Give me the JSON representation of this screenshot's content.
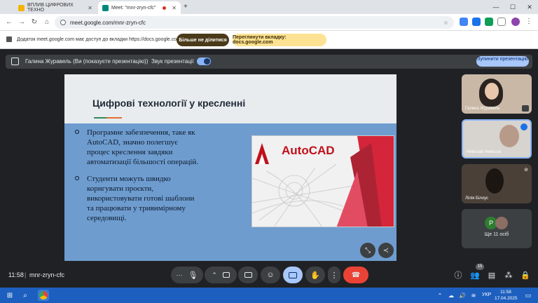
{
  "browser": {
    "tabs": [
      {
        "label": "ВПЛИВ ЦИФРОВИХ ТЕХНО",
        "favicon_color": "#f4b400"
      },
      {
        "label": "Meet: \"mnr-zryn-cfc\"",
        "favicon_color": "#00897b"
      }
    ],
    "new_tab": "+",
    "url": "meet.google.com/mnr-zryn-cfc",
    "window_controls": {
      "minimize": "—",
      "maximize": "☐",
      "close": "✕"
    }
  },
  "infobar": {
    "text": "Додаток meet.google.com має доступ до вкладки https://docs.google.com",
    "stop_sharing": "Більше не ділитися",
    "view_tab": "Переглянути вкладку: docs.google.com"
  },
  "presentation_bar": {
    "presenter": "Галина Журавель (Ви (показуєте презентацію))",
    "sound_label": "Звук презентації",
    "sound_on": true,
    "stop_button": "Зупинити презентацію"
  },
  "slide": {
    "title": "Цифрові технології у кресленні",
    "bullets": [
      [
        "Програмне забезпечення, таке як",
        "AutoCAD, значно полегшує",
        "процес креслення завдяки",
        "автоматизації більшості операцій."
      ],
      [
        "Студенти можуть швидко",
        "коригувати проєкти,",
        "використовувати готові шаблони",
        "та працювати у тривимірному",
        "середовищі."
      ]
    ],
    "image_text": "AutoCAD"
  },
  "participants": [
    {
      "name": "Галина Журавель",
      "bg": "#c9b8a6"
    },
    {
      "name": "Николай Невесов",
      "bg": "#d7d3cf"
    },
    {
      "name": "Лілія Білоус",
      "bg": "#4a4038"
    }
  ],
  "others": {
    "label": "Ще 11 осіб",
    "avatar_letter": "P"
  },
  "bottom": {
    "time": "11:58",
    "meeting_code": "mnr-zryn-cfc",
    "participant_count": "15"
  },
  "taskbar": {
    "language": "УКР",
    "clock_time": "11:58",
    "clock_date": "17.04.2025"
  },
  "colors": {
    "accent": "#8ab4f8",
    "end_call": "#ea4335",
    "present_active": "#a8c7fa"
  }
}
